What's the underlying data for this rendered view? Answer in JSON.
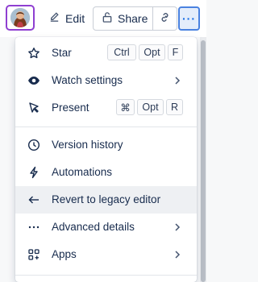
{
  "toolbar": {
    "edit_label": "Edit",
    "share_label": "Share",
    "more_label": "···"
  },
  "menu": {
    "star": {
      "label": "Star",
      "shortcut": [
        "Ctrl",
        "Opt",
        "F"
      ]
    },
    "watch": {
      "label": "Watch settings"
    },
    "present": {
      "label": "Present",
      "shortcut": [
        "⌘",
        "Opt",
        "R"
      ]
    },
    "version_history": {
      "label": "Version history"
    },
    "automations": {
      "label": "Automations"
    },
    "revert": {
      "label": "Revert to legacy editor"
    },
    "advanced": {
      "label": "Advanced details"
    },
    "apps": {
      "label": "Apps"
    }
  },
  "colors": {
    "accent": "#0c66e4",
    "avatar_border": "#8f3fd1",
    "hover_row": "#eef0f3"
  }
}
